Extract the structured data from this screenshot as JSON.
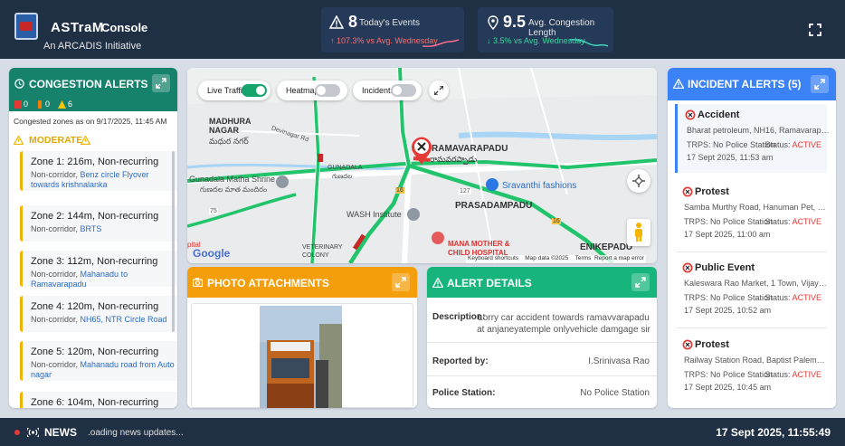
{
  "header": {
    "brand": "ASTraM",
    "console": "Console",
    "subtitle": "An ARCADIS Initiative",
    "stats": [
      {
        "value": "8",
        "label": "Today's Events",
        "trend": "↑ 107.3% vs Avg. Wednesday",
        "trend_color": "#ff6b6b",
        "icon": "warning-icon"
      },
      {
        "value": "9.5",
        "label": "Avg. Congestion Length",
        "trend": "↓ 3.5% vs Avg. Wednesday",
        "trend_color": "#3fd6a0",
        "icon": "location-pin-icon"
      }
    ]
  },
  "congestion": {
    "title": "CONGESTION ALERTS",
    "counts": [
      "0",
      "0",
      "6"
    ],
    "as_of": "Congested zones as on 9/17/2025, 11:45 AM",
    "severity": "MODERATE",
    "zones": [
      {
        "title": "Zone 1: 216m, Non-recurring",
        "prefix": "Non-corridor, ",
        "road": "Benz circle Flyover towards krishnalanka"
      },
      {
        "title": "Zone 2: 144m, Non-recurring",
        "prefix": "Non-corridor, ",
        "road": "BRTS"
      },
      {
        "title": "Zone 3: 112m, Non-recurring",
        "prefix": "Non-corridor, ",
        "road": "Mahanadu to Ramavarapadu"
      },
      {
        "title": "Zone 4: 120m, Non-recurring",
        "prefix": "Non-corridor, ",
        "road": "NH65, NTR Circle Road"
      },
      {
        "title": "Zone 5: 120m, Non-recurring",
        "prefix": "Non-corridor, ",
        "road": "Mahanadu road from Auto nagar"
      },
      {
        "title": "Zone 6: 104m, Non-recurring",
        "prefix": "",
        "road": ""
      }
    ]
  },
  "map": {
    "toggles": [
      {
        "label": "Live Traffic",
        "on": true
      },
      {
        "label": "Heatmap",
        "on": false
      },
      {
        "label": "Incidents",
        "on": false
      }
    ],
    "labels": {
      "madhura": "MADHURA NAGAR",
      "madhura_te": "మధుర నగర్",
      "devinagar": "Devinagar Rd",
      "ramavarapadu": "RAMAVARAPADU",
      "ramavarapadu_te": "రామవరప్పాడు",
      "gunadala": "GUNADALA",
      "gunadala_te": "గుణదల",
      "shrine": "Gunadala Matha Shrine",
      "shrine_te": "గుణదల మాత మందిరం",
      "sravanthi": "Sravanthi fashions",
      "prasadampadu": "PRASADAMPADU",
      "wash": "WASH Institute",
      "veterinary": "VETERINARY COLONY",
      "mana": "MANA MOTHER & CHILD HOSPITAL",
      "enikepadu": "ENIKEPADU",
      "pital": "pital",
      "google": "Google",
      "shortcuts": "Keyboard shortcuts",
      "mapdata": "Map data ©2025",
      "terms": "Terms",
      "report": "Report a map error",
      "r75": "75",
      "r127": "127",
      "r16a": "16",
      "r16b": "16"
    }
  },
  "photo": {
    "title": "PHOTO ATTACHMENTS"
  },
  "alert": {
    "title": "ALERT DETAILS",
    "description_label": "Description:",
    "description": "Lorry car accident towards ramavvarapadu at anjaneyatemple onlyvehicle damgage sir",
    "reported_label": "Reported by:",
    "reported": "I.Srinivasa Rao",
    "station_label": "Police Station:",
    "station": "No Police Station"
  },
  "incidents": {
    "title": "INCIDENT ALERTS (5)",
    "items": [
      {
        "type": "Accident",
        "addr": "Bharat petroleum, NH16, Ramavarapadu, Vijayawada",
        "trps": "TRPS: No Police Station",
        "status_label": "Status: ",
        "status": "ACTIVE",
        "date": "17 Sept 2025, 11:53 am"
      },
      {
        "type": "Protest",
        "addr": "Samba Murthy Road, Hanuman Pet, Vijayawada",
        "trps": "TRPS: No Police Station",
        "status_label": "Status: ",
        "status": "ACTIVE",
        "date": "17 Sept 2025, 11:00 am"
      },
      {
        "type": "Public Event",
        "addr": "Kaleswara Rao Market, 1 Town, Vijayawada",
        "trps": "TRPS: No Police Station",
        "status_label": "Status: ",
        "status": "ACTIVE",
        "date": "17 Sept 2025, 10:52 am"
      },
      {
        "type": "Protest",
        "addr": "Railway Station Road, Baptist Palem, Hanuman Pet",
        "trps": "TRPS: No Police Station",
        "status_label": "Status: ",
        "status": "ACTIVE",
        "date": "17 Sept 2025, 10:45 am"
      }
    ]
  },
  "news": {
    "label": "NEWS",
    "text": ".oading news updates...",
    "datetime": "17 Sept 2025, 11:55:49"
  }
}
